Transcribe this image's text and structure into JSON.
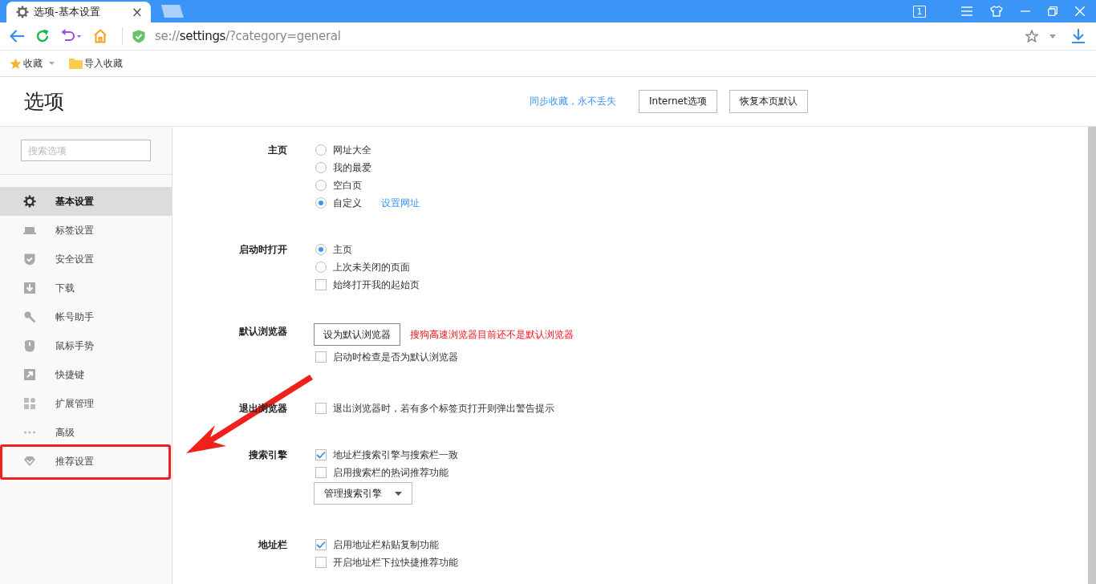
{
  "tab": {
    "title": "选项-基本设置",
    "close": "×"
  },
  "window_controls": {
    "tab_count": "1"
  },
  "address_bar": {
    "scheme": "se://",
    "host": "settings",
    "path": "/?category=general"
  },
  "bookmarks": [
    {
      "label": "收藏",
      "kind": "star"
    },
    {
      "label": "导入收藏",
      "kind": "folder"
    }
  ],
  "header": {
    "title": "选项",
    "sync_link": "同步收藏，永不丢失",
    "buttons": [
      "Internet选项",
      "恢复本页默认"
    ]
  },
  "sidebar": {
    "search_placeholder": "搜索选项",
    "items": [
      {
        "label": "基本设置",
        "selected": true
      },
      {
        "label": "标签设置",
        "selected": false
      },
      {
        "label": "安全设置",
        "selected": false
      },
      {
        "label": "下载",
        "selected": false
      },
      {
        "label": "帐号助手",
        "selected": false
      },
      {
        "label": "鼠标手势",
        "selected": false
      },
      {
        "label": "快捷键",
        "selected": false
      },
      {
        "label": "扩展管理",
        "selected": false
      },
      {
        "label": "高级",
        "selected": false
      },
      {
        "label": "推荐设置",
        "selected": false,
        "highlighted": true
      }
    ]
  },
  "sections": [
    {
      "label": "主页",
      "controls": [
        {
          "kind": "radio",
          "label": "网址大全",
          "selected": false
        },
        {
          "kind": "radio",
          "label": "我的最爱",
          "selected": false
        },
        {
          "kind": "radio",
          "label": "空白页",
          "selected": false
        },
        {
          "kind": "radio",
          "label": "自定义",
          "selected": true,
          "link": "设置网址"
        }
      ]
    },
    {
      "label": "启动时打开",
      "controls": [
        {
          "kind": "radio",
          "label": "主页",
          "selected": true
        },
        {
          "kind": "radio",
          "label": "上次未关闭的页面",
          "selected": false
        },
        {
          "kind": "checkbox",
          "label": "始终打开我的起始页",
          "checked": false
        }
      ]
    },
    {
      "label": "默认浏览器",
      "controls": [
        {
          "kind": "button",
          "label": "设为默认浏览器",
          "note": "搜狗高速浏览器目前还不是默认浏览器"
        },
        {
          "kind": "checkbox",
          "label": "启动时检查是否为默认浏览器",
          "checked": false
        }
      ]
    },
    {
      "label": "退出浏览器",
      "controls": [
        {
          "kind": "checkbox",
          "label": "退出浏览器时，若有多个标签页打开则弹出警告提示",
          "checked": false
        }
      ]
    },
    {
      "label": "搜索引擎",
      "controls": [
        {
          "kind": "checkbox",
          "label": "地址栏搜索引擎与搜索栏一致",
          "checked": true
        },
        {
          "kind": "checkbox",
          "label": "启用搜索栏的热词推荐功能",
          "checked": false
        },
        {
          "kind": "dropdown",
          "label": "管理搜索引擎"
        }
      ]
    },
    {
      "label": "地址栏",
      "controls": [
        {
          "kind": "checkbox",
          "label": "启用地址栏粘贴复制功能",
          "checked": true
        },
        {
          "kind": "checkbox",
          "label": "开启地址栏下拉快捷推荐功能",
          "checked": false
        }
      ]
    }
  ]
}
